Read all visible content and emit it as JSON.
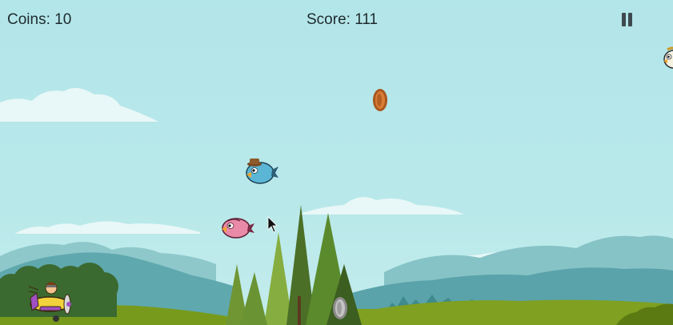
{
  "hud": {
    "coins_label": "Coins:",
    "coins_value": "10",
    "score_label": "Score:",
    "score_value": "111",
    "pause_icon": "pause-icon"
  },
  "colors": {
    "sky": "#b5e6ea",
    "cloud": "#e9f8f8",
    "far_mountain": "#8fc9cc",
    "mid_mountain": "#62aab0",
    "hill_green": "#7a9c1c",
    "hill_dark": "#5d7d14",
    "tree_green": "#7ba33a",
    "tree_dark": "#4a6e26",
    "coin_bronze": "#c8702e",
    "coin_silver": "#a9a9a9",
    "bird_blue": "#5bb7d6",
    "bird_pink": "#e88aa8",
    "plane_yellow": "#f2d23c"
  }
}
